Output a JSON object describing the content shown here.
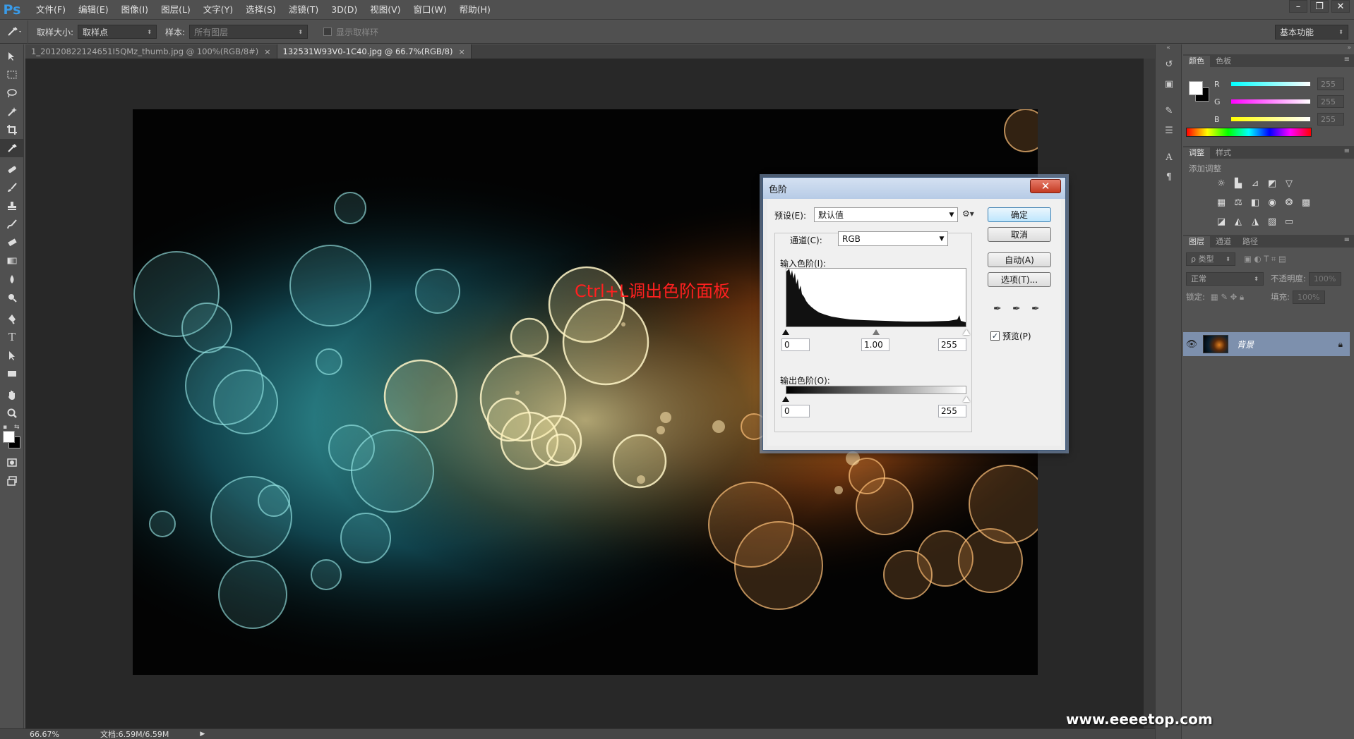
{
  "app": {
    "logo": "Ps"
  },
  "menu": [
    "文件(F)",
    "编辑(E)",
    "图像(I)",
    "图层(L)",
    "文字(Y)",
    "选择(S)",
    "滤镜(T)",
    "3D(D)",
    "视图(V)",
    "窗口(W)",
    "帮助(H)"
  ],
  "window_controls": {
    "minimize": "–",
    "restore": "❐",
    "close": "✕"
  },
  "options": {
    "sample_size_label": "取样大小:",
    "sample_size_value": "取样点",
    "sample_label": "样本:",
    "sample_value": "所有图层",
    "show_ring_label": "显示取样环",
    "workspace": "基本功能"
  },
  "tabs": [
    {
      "label": "1_20120822124651I5QMz_thumb.jpg @ 100%(RGB/8#)",
      "close": "×"
    },
    {
      "label": "132531W93V0-1C40.jpg @ 66.7%(RGB/8)",
      "close": "×"
    }
  ],
  "canvas": {
    "annotation": "Ctrl+L调出色阶面板"
  },
  "status": {
    "zoom": "66.67%",
    "doc": "文档:6.59M/6.59M",
    "arrow": "▶"
  },
  "panels": {
    "color": {
      "tabs": [
        "颜色",
        "色板"
      ],
      "r_label": "R",
      "g_label": "G",
      "b_label": "B",
      "r_value": "255",
      "g_value": "255",
      "b_value": "255"
    },
    "adjust": {
      "tabs": [
        "调整",
        "样式"
      ],
      "title": "添加调整"
    },
    "layers": {
      "tabs": [
        "图层",
        "通道",
        "路径"
      ],
      "filter": "ρ 类型",
      "blend": "正常",
      "opacity_label": "不透明度:",
      "opacity_value": "100%",
      "lock_label": "锁定:",
      "fill_label": "填充:",
      "fill_value": "100%",
      "layer_name": "背景"
    },
    "menu_icon": "≡"
  },
  "dialog": {
    "title": "色阶",
    "close": "✕",
    "preset_label": "预设(E):",
    "preset_value": "默认值",
    "channel_label": "通道(C):",
    "channel_value": "RGB",
    "input_label": "输入色阶(I):",
    "input_black": "0",
    "input_gamma": "1.00",
    "input_white": "255",
    "output_label": "输出色阶(O):",
    "output_black": "0",
    "output_white": "255",
    "buttons": {
      "ok": "确定",
      "cancel": "取消",
      "auto": "自动(A)",
      "options": "选项(T)..."
    },
    "preview_label": "预览(P)",
    "preview_checked": true
  },
  "watermark": "www.eeeetop.com"
}
